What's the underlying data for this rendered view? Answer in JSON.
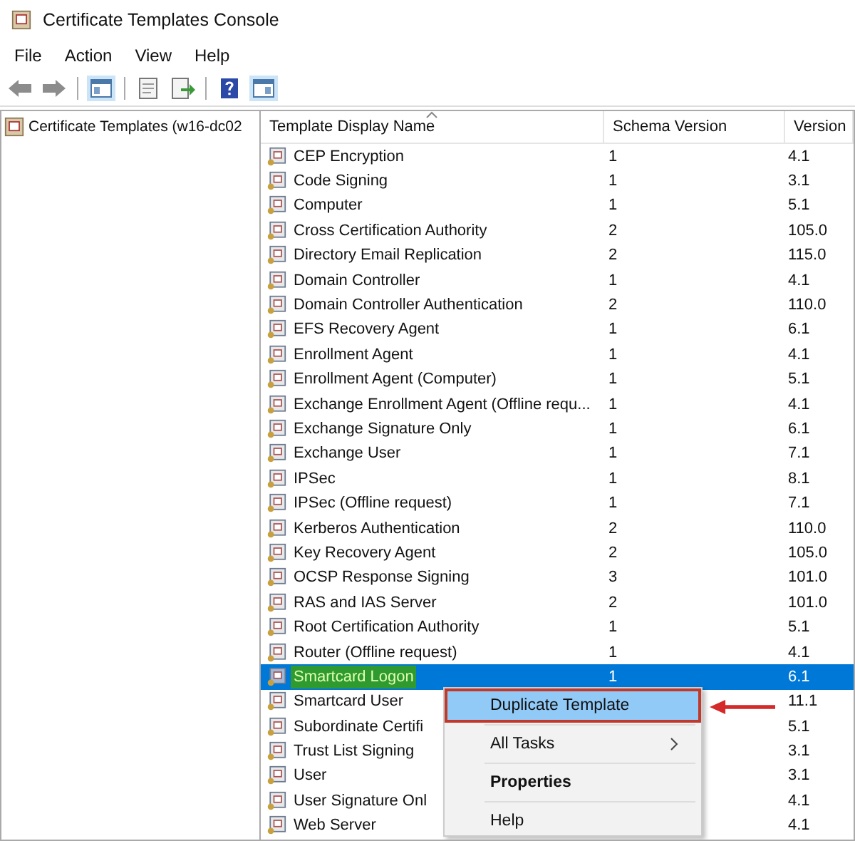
{
  "window": {
    "title": "Certificate Templates Console"
  },
  "menu": [
    "File",
    "Action",
    "View",
    "Help"
  ],
  "tree": {
    "label": "Certificate Templates (w16-dc02"
  },
  "table": {
    "columns": [
      {
        "label": "Template Display Name",
        "sorted": true
      },
      {
        "label": "Schema Version",
        "sorted": false
      },
      {
        "label": "Version",
        "sorted": false
      }
    ],
    "rows": [
      {
        "name": "CEP Encryption",
        "schema": "1",
        "version": "4.1",
        "selected": false,
        "highlighted": false
      },
      {
        "name": "Code Signing",
        "schema": "1",
        "version": "3.1",
        "selected": false,
        "highlighted": false
      },
      {
        "name": "Computer",
        "schema": "1",
        "version": "5.1",
        "selected": false,
        "highlighted": false
      },
      {
        "name": "Cross Certification Authority",
        "schema": "2",
        "version": "105.0",
        "selected": false,
        "highlighted": false
      },
      {
        "name": "Directory Email Replication",
        "schema": "2",
        "version": "115.0",
        "selected": false,
        "highlighted": false
      },
      {
        "name": "Domain Controller",
        "schema": "1",
        "version": "4.1",
        "selected": false,
        "highlighted": false
      },
      {
        "name": "Domain Controller Authentication",
        "schema": "2",
        "version": "110.0",
        "selected": false,
        "highlighted": false
      },
      {
        "name": "EFS Recovery Agent",
        "schema": "1",
        "version": "6.1",
        "selected": false,
        "highlighted": false
      },
      {
        "name": "Enrollment Agent",
        "schema": "1",
        "version": "4.1",
        "selected": false,
        "highlighted": false
      },
      {
        "name": "Enrollment Agent (Computer)",
        "schema": "1",
        "version": "5.1",
        "selected": false,
        "highlighted": false
      },
      {
        "name": "Exchange Enrollment Agent (Offline requ...",
        "schema": "1",
        "version": "4.1",
        "selected": false,
        "highlighted": false
      },
      {
        "name": "Exchange Signature Only",
        "schema": "1",
        "version": "6.1",
        "selected": false,
        "highlighted": false
      },
      {
        "name": "Exchange User",
        "schema": "1",
        "version": "7.1",
        "selected": false,
        "highlighted": false
      },
      {
        "name": "IPSec",
        "schema": "1",
        "version": "8.1",
        "selected": false,
        "highlighted": false
      },
      {
        "name": "IPSec (Offline request)",
        "schema": "1",
        "version": "7.1",
        "selected": false,
        "highlighted": false
      },
      {
        "name": "Kerberos Authentication",
        "schema": "2",
        "version": "110.0",
        "selected": false,
        "highlighted": false
      },
      {
        "name": "Key Recovery Agent",
        "schema": "2",
        "version": "105.0",
        "selected": false,
        "highlighted": false
      },
      {
        "name": "OCSP Response Signing",
        "schema": "3",
        "version": "101.0",
        "selected": false,
        "highlighted": false
      },
      {
        "name": "RAS and IAS Server",
        "schema": "2",
        "version": "101.0",
        "selected": false,
        "highlighted": false
      },
      {
        "name": "Root Certification Authority",
        "schema": "1",
        "version": "5.1",
        "selected": false,
        "highlighted": false
      },
      {
        "name": "Router (Offline request)",
        "schema": "1",
        "version": "4.1",
        "selected": false,
        "highlighted": false
      },
      {
        "name": "Smartcard Logon",
        "schema": "1",
        "version": "6.1",
        "selected": true,
        "highlighted": true
      },
      {
        "name": "Smartcard User",
        "version": "11.1",
        "selected": false,
        "highlighted": false
      },
      {
        "name": "Subordinate Certifi",
        "version": "5.1",
        "selected": false,
        "highlighted": false
      },
      {
        "name": "Trust List Signing",
        "version": "3.1",
        "selected": false,
        "highlighted": false
      },
      {
        "name": "User",
        "version": "3.1",
        "selected": false,
        "highlighted": false
      },
      {
        "name": "User Signature Onl",
        "version": "4.1",
        "selected": false,
        "highlighted": false
      },
      {
        "name": "Web Server",
        "version": "4.1",
        "selected": false,
        "highlighted": false
      }
    ]
  },
  "context_menu": {
    "items": [
      {
        "label": "Duplicate Template",
        "kind": "item",
        "hovered": true,
        "bold": false,
        "annotated": true
      },
      {
        "label": "All Tasks",
        "kind": "submenu",
        "hovered": false,
        "bold": false,
        "annotated": false
      },
      {
        "label": "Properties",
        "kind": "item",
        "hovered": false,
        "bold": true,
        "annotated": false
      },
      {
        "label": "Help",
        "kind": "item",
        "hovered": false,
        "bold": false,
        "annotated": false
      }
    ]
  }
}
